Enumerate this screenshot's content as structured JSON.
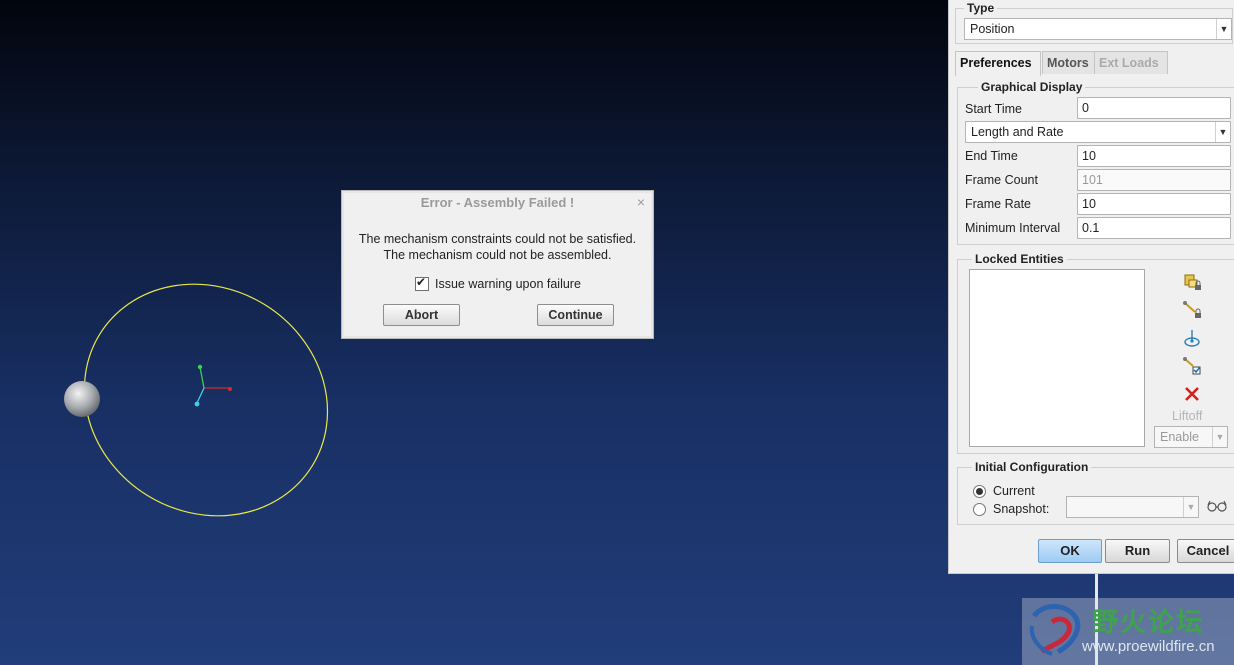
{
  "error_dialog": {
    "title": "Error - Assembly Failed !",
    "close_glyph": "×",
    "message_line1": "The mechanism constraints could not be satisfied.",
    "message_line2": "The mechanism could not be assembled.",
    "checkbox_label": "Issue warning upon failure",
    "checkbox_checked": true,
    "abort_label": "Abort",
    "continue_label": "Continue"
  },
  "panel": {
    "type_group_title": "Type",
    "type_value": "Position",
    "tabs": [
      {
        "label": "Preferences",
        "state": "active"
      },
      {
        "label": "Motors",
        "state": "normal"
      },
      {
        "label": "Ext Loads",
        "state": "disabled"
      }
    ],
    "graphical_display": {
      "title": "Graphical Display",
      "start_time_label": "Start Time",
      "start_time_value": "0",
      "mode_value": "Length and Rate",
      "end_time_label": "End Time",
      "end_time_value": "10",
      "frame_count_label": "Frame Count",
      "frame_count_value": "101",
      "frame_rate_label": "Frame Rate",
      "frame_rate_value": "10",
      "min_interval_label": "Minimum Interval",
      "min_interval_value": "0.1"
    },
    "locked_entities": {
      "title": "Locked Entities",
      "liftoff_label": "Liftoff",
      "liftoff_value": "Enable"
    },
    "initial_configuration": {
      "title": "Initial Configuration",
      "current_label": "Current",
      "snapshot_label": "Snapshot:",
      "selected": "Current"
    },
    "buttons": {
      "ok": "OK",
      "run": "Run",
      "cancel": "Cancel"
    }
  },
  "watermark": {
    "text_cn": "野火论坛",
    "url": "www.proewildfire.cn"
  },
  "colors": {
    "trajectory": "#e8e84a",
    "axis_x": "#d22b2b",
    "axis_y": "#3ccf4e",
    "axis_z": "#3fd0e8",
    "ok_button": "#a9d1f5"
  }
}
